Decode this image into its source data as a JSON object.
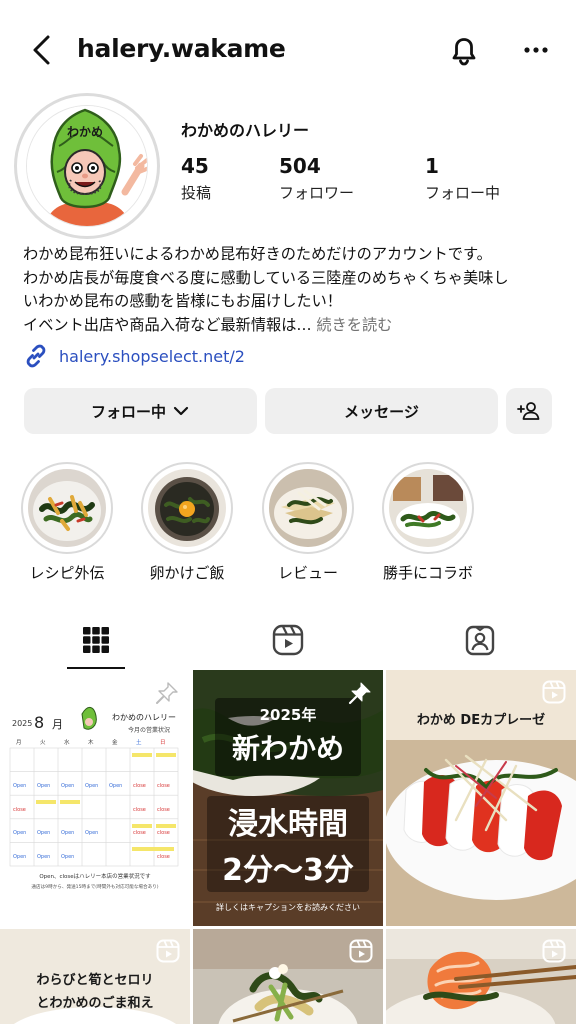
{
  "header": {
    "username": "halery.wakame"
  },
  "profile": {
    "display_name": "わかめのハレリー",
    "avatar_text": "わかめ",
    "stats": [
      {
        "value": "45",
        "label": "投稿"
      },
      {
        "value": "504",
        "label": "フォロワー"
      },
      {
        "value": "1",
        "label": "フォロー中"
      }
    ],
    "bio_lines": [
      "わかめ昆布狂いによるわかめ昆布好きのためだけのアカウントです。",
      "わかめ店長が毎度食べる度に感動している三陸産のめちゃくちゃ美味し",
      "いわかめ昆布の感動を皆様にもお届けしたい！",
      "イベント出店や商品入荷など最新情報は…"
    ],
    "bio_more": "続きを読む",
    "link": "halery.shopselect.net/2"
  },
  "actions": {
    "following_label": "フォロー中",
    "message_label": "メッセージ"
  },
  "highlights": [
    {
      "label": "レシピ外伝"
    },
    {
      "label": "卵かけご飯"
    },
    {
      "label": "レビュー"
    },
    {
      "label": "勝手にコラボ"
    }
  ],
  "posts": {
    "calendar": {
      "year": "2025",
      "month": "8",
      "month_unit": "月",
      "brand": "わかめのハレリー",
      "subtitle": "今月の営業状況",
      "weekdays": [
        "月",
        "火",
        "水",
        "木",
        "金",
        "土",
        "日"
      ],
      "legend": "Open、closeはハレリー本店の営業状況です",
      "note": "通店は9時から、発送15時まで(時間外も対応可能な場合あり)"
    },
    "news": {
      "year_line": "2025年",
      "title": "新わかめ",
      "line1": "浸水時間",
      "line2": "2分〜3分",
      "caption": "詳しくはキャプションをお読みください"
    },
    "caprese": {
      "title": "わかめ DEカプレーゼ"
    },
    "aemono": {
      "line1": "わらびと筍とセロリ",
      "line2": "とわかめのごま和え"
    }
  },
  "colors": {
    "link": "#2b4fbf",
    "button_bg": "#efefef",
    "muted": "#737373",
    "wakame_green": "#6fbf3a"
  }
}
